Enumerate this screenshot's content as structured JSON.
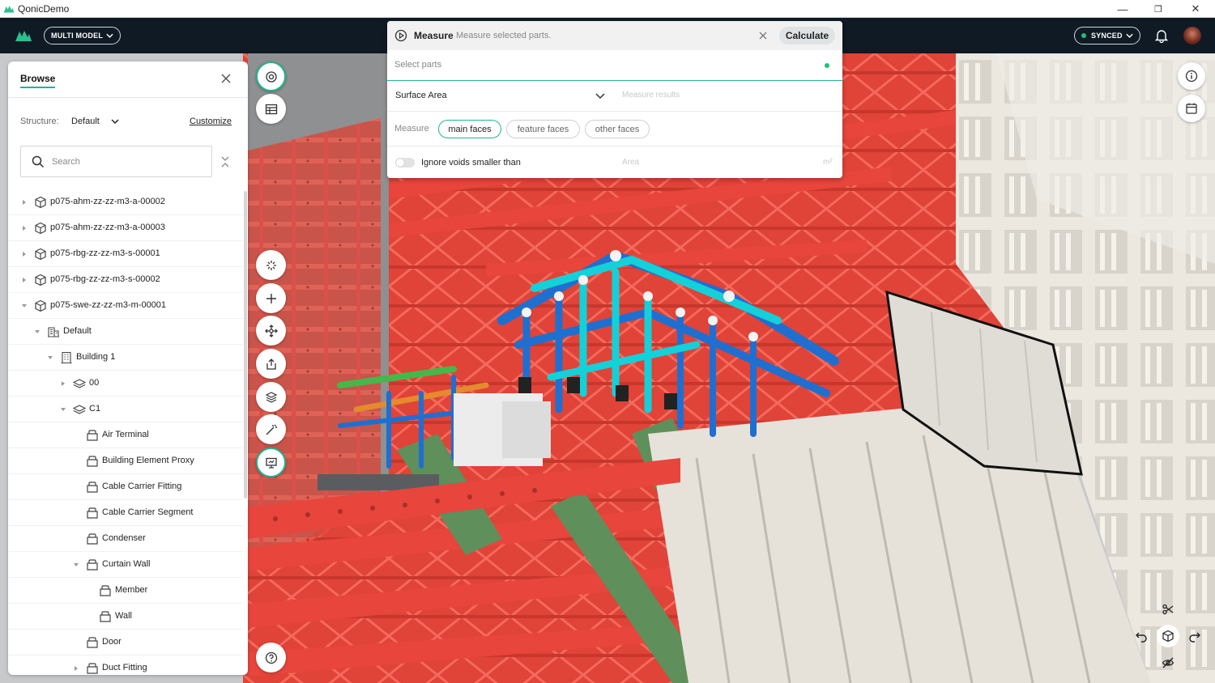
{
  "window": {
    "title": "QonicDemo",
    "controls": {
      "minimize": "—",
      "restore": "❐",
      "close": "✕"
    }
  },
  "appbar": {
    "model_button": "MULTI MODEL",
    "sync_button": "SYNCED"
  },
  "browse": {
    "tab": "Browse",
    "structure_label": "Structure:",
    "structure_value": "Default",
    "customize": "Customize",
    "search_placeholder": "Search",
    "tree": [
      {
        "label": "p075-ahm-zz-zz-m3-a-00002",
        "depth": 0,
        "toggle": "collapsed",
        "icon": "model-cube-icon"
      },
      {
        "label": "p075-ahm-zz-zz-m3-a-00003",
        "depth": 0,
        "toggle": "collapsed",
        "icon": "model-cube-icon"
      },
      {
        "label": "p075-rbg-zz-zz-m3-s-00001",
        "depth": 0,
        "toggle": "collapsed",
        "icon": "model-cube-icon"
      },
      {
        "label": "p075-rbg-zz-zz-m3-s-00002",
        "depth": 0,
        "toggle": "collapsed",
        "icon": "model-cube-icon"
      },
      {
        "label": "p075-swe-zz-zz-m3-m-00001",
        "depth": 0,
        "toggle": "expanded",
        "icon": "model-cube-icon"
      },
      {
        "label": "Default",
        "depth": 1,
        "toggle": "expanded",
        "icon": "site-icon"
      },
      {
        "label": "Building 1",
        "depth": 2,
        "toggle": "expanded",
        "icon": "building-icon"
      },
      {
        "label": "00",
        "depth": 3,
        "toggle": "collapsed",
        "icon": "storey-layers-icon"
      },
      {
        "label": "C1",
        "depth": 3,
        "toggle": "expanded",
        "icon": "storey-layers-icon"
      },
      {
        "label": "Air Terminal",
        "depth": 4,
        "toggle": "none",
        "icon": "element-class-icon"
      },
      {
        "label": "Building Element Proxy",
        "depth": 4,
        "toggle": "none",
        "icon": "element-class-icon"
      },
      {
        "label": "Cable Carrier Fitting",
        "depth": 4,
        "toggle": "none",
        "icon": "element-class-icon"
      },
      {
        "label": "Cable Carrier Segment",
        "depth": 4,
        "toggle": "none",
        "icon": "element-class-icon"
      },
      {
        "label": "Condenser",
        "depth": 4,
        "toggle": "none",
        "icon": "element-class-icon"
      },
      {
        "label": "Curtain Wall",
        "depth": 4,
        "toggle": "expanded",
        "icon": "element-class-icon"
      },
      {
        "label": "Member",
        "depth": 5,
        "toggle": "none",
        "icon": "element-class-icon"
      },
      {
        "label": "Wall",
        "depth": 5,
        "toggle": "none",
        "icon": "element-class-icon"
      },
      {
        "label": "Door",
        "depth": 4,
        "toggle": "none",
        "icon": "element-class-icon"
      },
      {
        "label": "Duct Fitting",
        "depth": 4,
        "toggle": "collapsed",
        "icon": "element-class-icon"
      }
    ]
  },
  "measure": {
    "title": "Measure",
    "subtitle": "Measure selected parts.",
    "calculate": "Calculate",
    "select_placeholder": "Select parts",
    "mode_value": "Surface Area",
    "results_placeholder": "Measure results",
    "faces_label": "Measure",
    "chips": [
      {
        "label": "main faces",
        "selected": true
      },
      {
        "label": "feature faces",
        "selected": false
      },
      {
        "label": "other faces",
        "selected": false
      }
    ],
    "voids_label": "Ignore voids smaller than",
    "voids_on": false,
    "area_placeholder": "Area",
    "area_unit": "m²"
  },
  "colors": {
    "accent": "#20b58f",
    "appbar": "#0f1a24",
    "steel_red": "#e8453c",
    "pipe_blue": "#1f6fd1",
    "pipe_cyan": "#14d0d8",
    "brace_green": "#5f8f5a",
    "facade": "#e9e5dc"
  },
  "icons": {
    "left_rail": [
      "target-icon",
      "table-icon",
      "sparkle-icon",
      "plus-icon",
      "move-icon",
      "export-icon",
      "box-layers-icon",
      "magic-wand-icon",
      "presentation-icon",
      "help-icon"
    ],
    "right_top": [
      "info-icon",
      "calendar-icon"
    ],
    "gizmo": [
      "scissors-icon",
      "undo-icon",
      "view-cube-icon",
      "redo-icon",
      "hide-icon"
    ]
  }
}
